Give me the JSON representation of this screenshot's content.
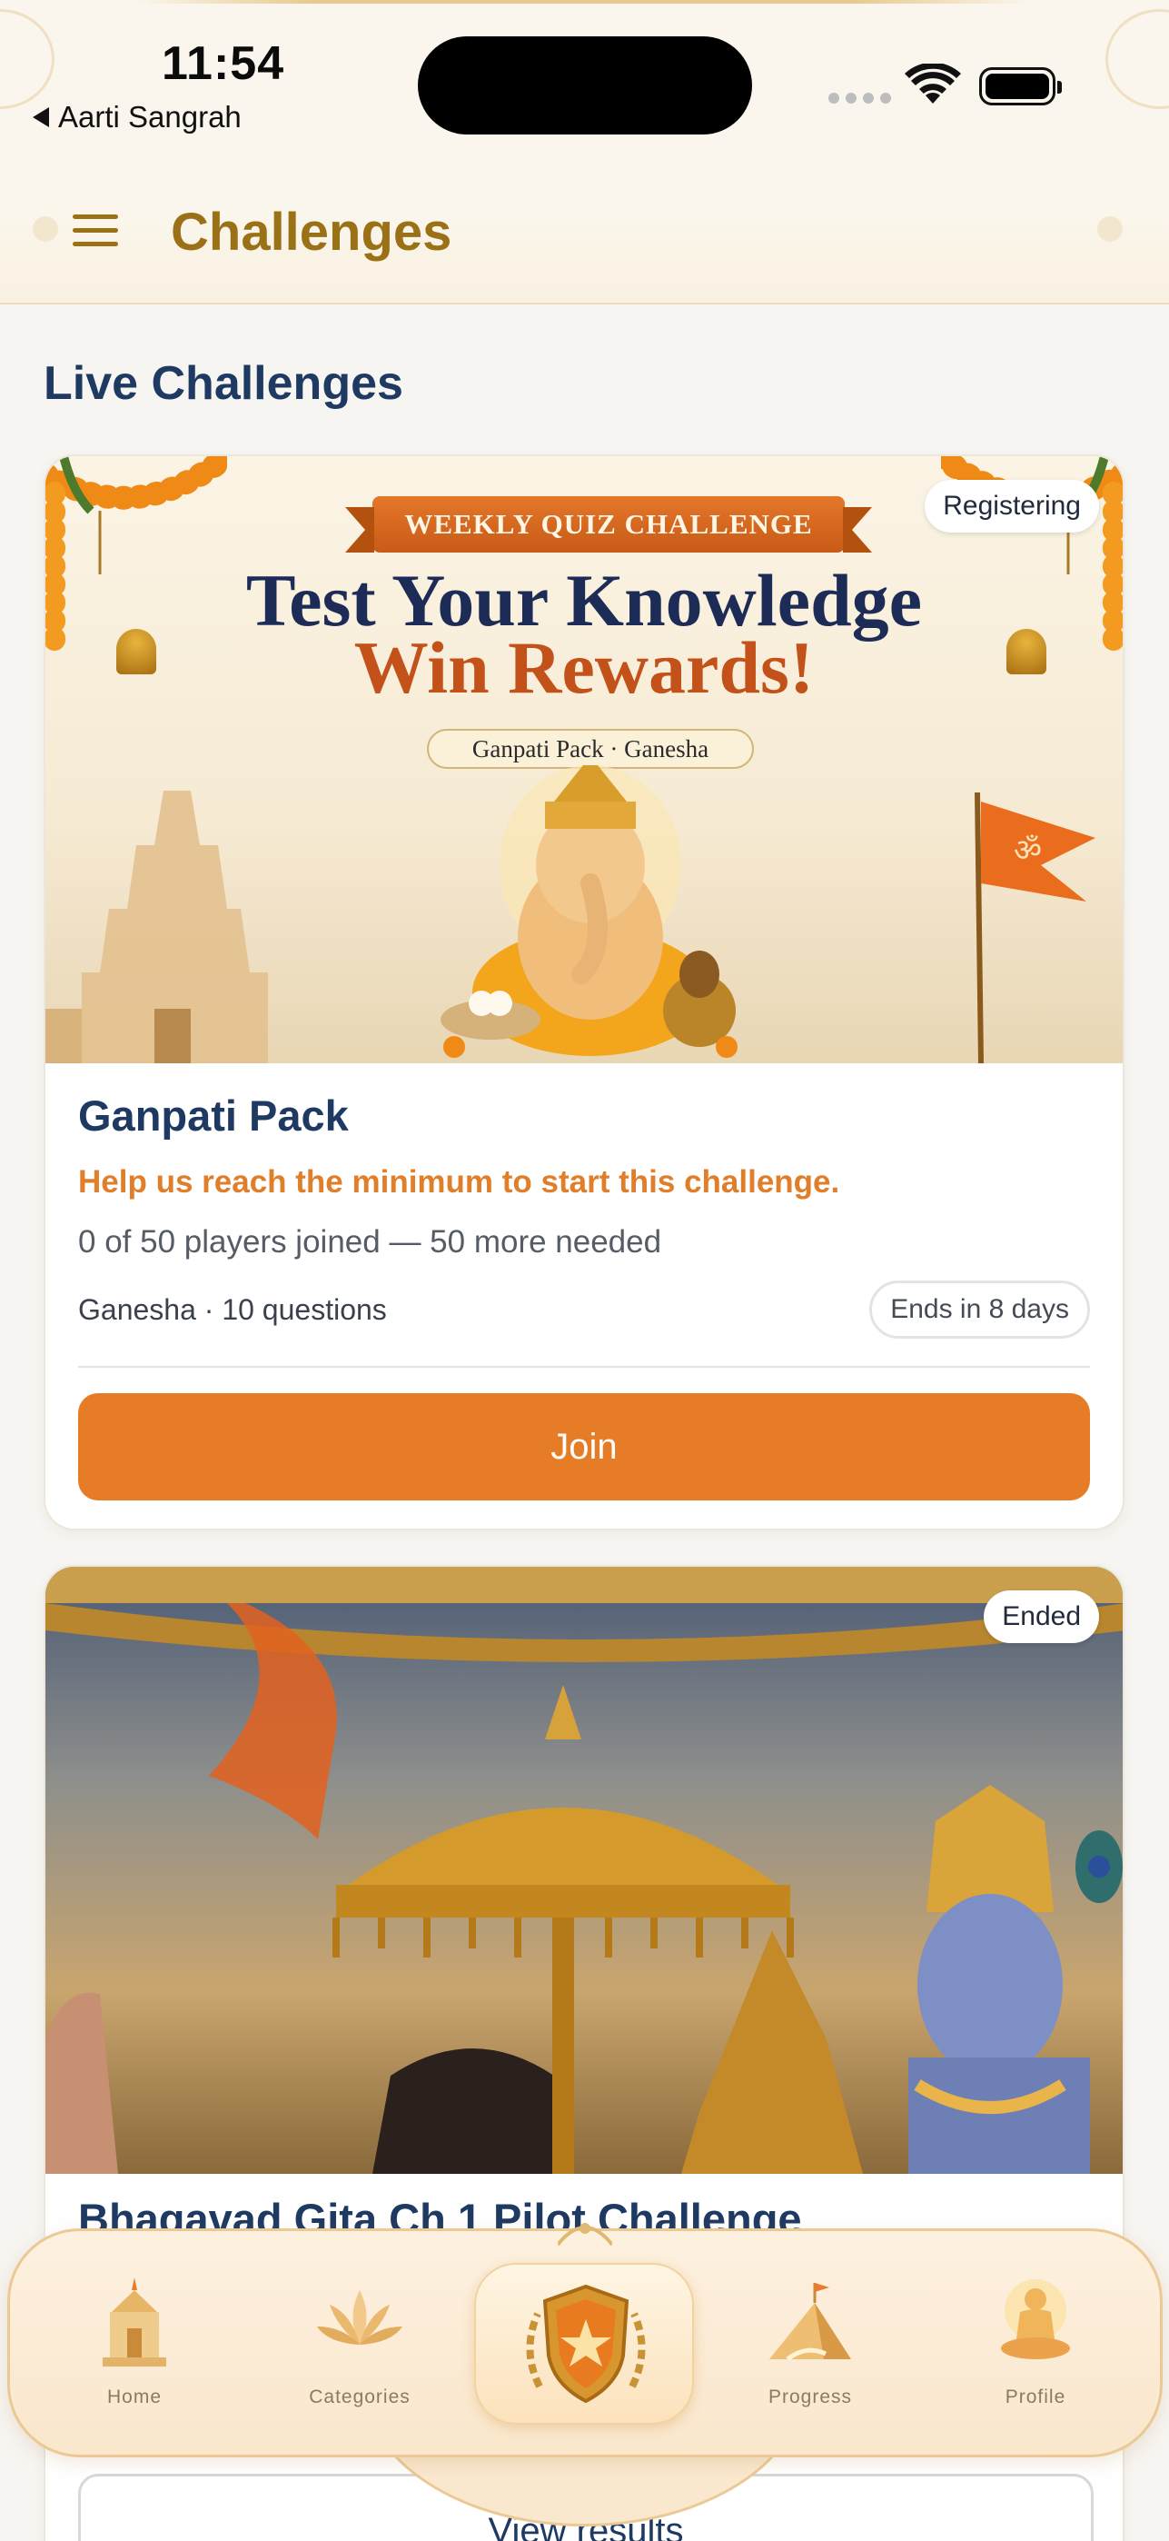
{
  "status_bar": {
    "time": "11:54",
    "back_app": "Aarti Sangrah",
    "icons": [
      "cellular-dots-icon",
      "wifi-icon",
      "battery-icon"
    ]
  },
  "header": {
    "title": "Challenges",
    "menu_icon": "hamburger-menu-icon"
  },
  "section_title": "Live Challenges",
  "challenges": [
    {
      "status": "Registering",
      "banner": {
        "ribbon": "WEEKLY QUIZ CHALLENGE",
        "headline_1": "Test Your Knowledge",
        "headline_2": "Win Rewards!",
        "subtitle": "Ganpati Pack · Ganesha"
      },
      "title": "Ganpati Pack",
      "alert": "Help us reach the minimum to start this challenge.",
      "progress": "0 of 50 players joined — 50 more needed",
      "meta": "Ganesha · 10 questions",
      "ends": "Ends in 8 days",
      "action": "Join"
    },
    {
      "status": "Ended",
      "title": "Bhagavad Gita Ch 1 Pilot Challenge",
      "action": "View results"
    }
  ],
  "bottom_nav": {
    "items": [
      {
        "label": "Home",
        "icon": "temple-icon"
      },
      {
        "label": "Categories",
        "icon": "lotus-icon"
      },
      {
        "label": "",
        "icon": "shield-star-icon"
      },
      {
        "label": "Progress",
        "icon": "mountain-flag-icon"
      },
      {
        "label": "Profile",
        "icon": "meditation-icon"
      }
    ]
  },
  "colors": {
    "accent_gold": "#9a7117",
    "navy": "#1e3a63",
    "orange": "#e67c25",
    "alert_orange": "#e07e2a"
  }
}
